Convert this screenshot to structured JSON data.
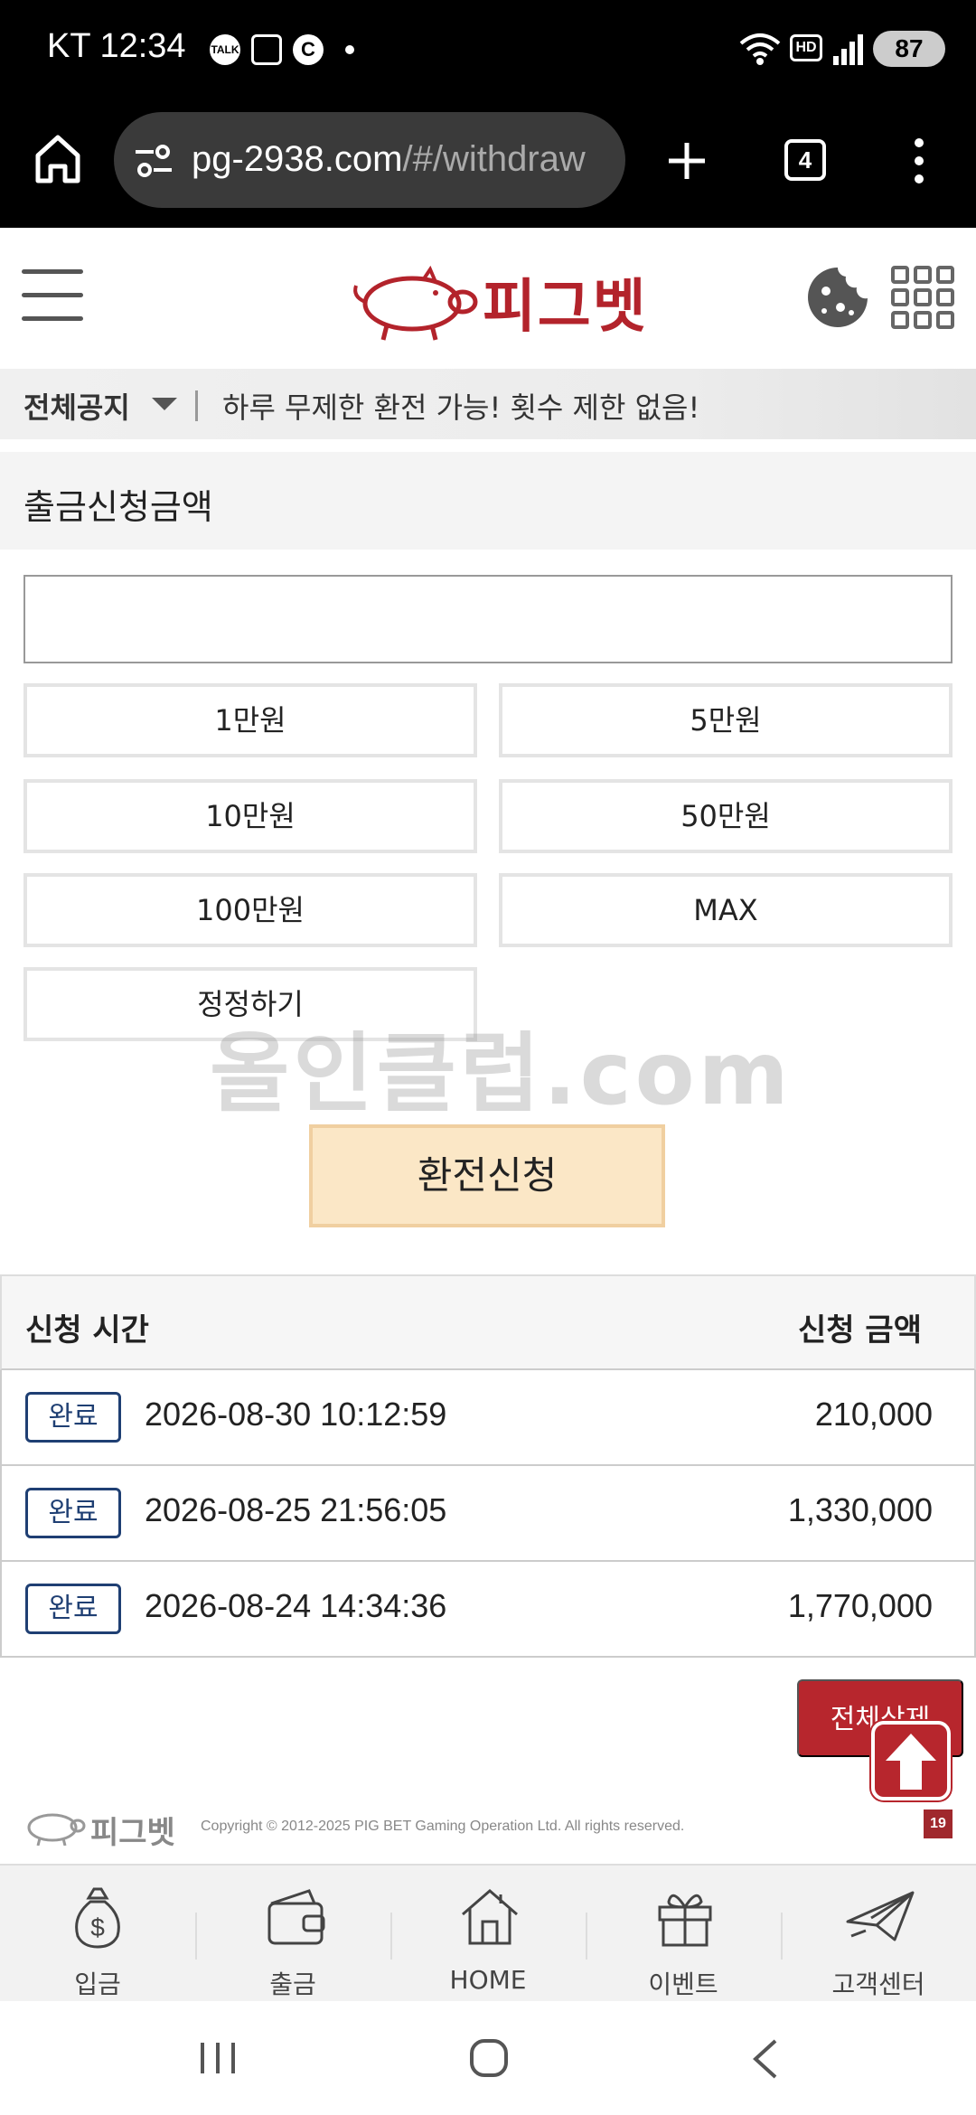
{
  "status_bar": {
    "carrier": "KT",
    "time": "12:34",
    "battery": "87",
    "icons": [
      "kakaotalk-icon",
      "screenshot-icon",
      "c-icon",
      "wifi-icon",
      "hd-icon",
      "signal-icon"
    ],
    "talk_badge": "TALK",
    "c_badge": "C",
    "hd_badge": "HD"
  },
  "browser": {
    "url_host": "pg-2938.com",
    "url_path": "/#/withdraw",
    "tab_count": "4"
  },
  "header": {
    "logo_text": "피그벳"
  },
  "notice": {
    "category": "전체공지",
    "message": "하루 무제한 환전 가능! 횟수 제한 없음!"
  },
  "withdraw": {
    "section_title": "출금신청금액",
    "input_value": "",
    "amount_buttons": [
      "1만원",
      "5만원",
      "10만원",
      "50만원",
      "100만원",
      "MAX",
      "정정하기"
    ],
    "submit_label": "환전신청"
  },
  "watermark": "올인클럽.com",
  "history": {
    "col_time": "신청 시간",
    "col_amount": "신청 금액",
    "rows": [
      {
        "status": "완료",
        "time": "2026-08-30 10:12:59",
        "amount": "210,000"
      },
      {
        "status": "완료",
        "time": "2026-08-25 21:56:05",
        "amount": "1,330,000"
      },
      {
        "status": "완료",
        "time": "2026-08-24 14:34:36",
        "amount": "1,770,000"
      }
    ],
    "delete_all_label": "전체삭제"
  },
  "footer": {
    "logo_text": "피그벳",
    "copyright": "Copyright © 2012-2025 PIG BET Gaming Operation Ltd. All rights reserved.",
    "age_badge": "19"
  },
  "bottom_nav": [
    {
      "label": "입금",
      "icon": "money-bag-icon"
    },
    {
      "label": "출금",
      "icon": "wallet-icon"
    },
    {
      "label": "HOME",
      "icon": "home-icon"
    },
    {
      "label": "이벤트",
      "icon": "gift-icon"
    },
    {
      "label": "고객센터",
      "icon": "paper-plane-icon"
    }
  ],
  "colors": {
    "brand_red": "#b7262d",
    "badge_blue": "#1f3f73",
    "submit_bg": "#fbe7c6"
  }
}
